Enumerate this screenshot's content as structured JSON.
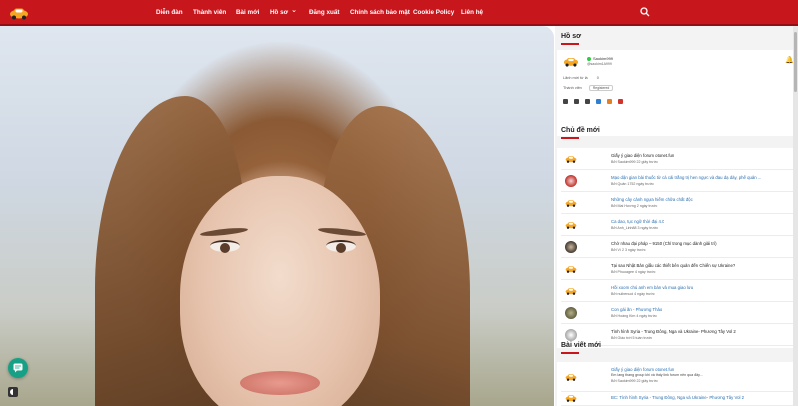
{
  "nav": {
    "items": [
      "Diễn đàn",
      "Thành viên",
      "Bài mới",
      "Hồ sơ",
      "Đăng xuất",
      "Chính sách bảo mật",
      "Cookie Policy",
      "Liên hệ"
    ],
    "search_icon": "search-icon",
    "brand_color": "#c8161d"
  },
  "profile": {
    "title": "Hồ sơ",
    "username": "Saokim999",
    "handle": "@saokim1A999",
    "row1_label": "Lãnh mới từ lá",
    "row1_value": "0",
    "row2_label": "Thành viên",
    "row2_tag": "Registered",
    "icons": [
      "user-icon",
      "settings-icon",
      "chat-icon",
      "mobile-icon",
      "rss-icon",
      "logout-icon"
    ]
  },
  "topics": {
    "title": "Chủ đề mới",
    "items": [
      {
        "title": "Giấy ý giao diện forum otonet.fun",
        "meta": "Bởi Saokim999 22 giây trước",
        "avatar": "car",
        "dark": true
      },
      {
        "title": "Mạo dận gian bài thuốc từ cá cải trắng trị hen ngực và đau dạ dày, phế quản ...",
        "meta": "Bởi Quân 1752 ngày trước",
        "avatar": "red",
        "dark": false
      },
      {
        "title": "Những cây cảnh ngựa hiếm chữa chất độc",
        "meta": "Bởi Mai Hương 2 ngày trước",
        "avatar": "car",
        "dark": false
      },
      {
        "title": "Ca dao, tục ngữ thời đại 4.0",
        "meta": "Bởi Anh_Linh88 3 ngày trước",
        "avatar": "car",
        "dark": false
      },
      {
        "title": "Chở nhau đại pháp – 9150 (Chỉ trong mục dành giải trí)",
        "meta": "Bởi Vì 2 3 ngày trước",
        "avatar": "dark",
        "dark": true
      },
      {
        "title": "Tại sao Nhật Bản giấu các thiết bên quản đến Chiến sự Ukraine?",
        "meta": "Bởi Phuoagee 4 ngày trước",
        "avatar": "car",
        "dark": true
      },
      {
        "title": "Hồi xoom chú anh em bàn và mua giao lưu",
        "meta": "Bởi nuibenuoi 4 ngày trước",
        "avatar": "car",
        "dark": false
      },
      {
        "title": "Con gái ăn - Phương Thảo",
        "meta": "Bởi Hoàng Kim 4 ngày trước",
        "avatar": "olive",
        "dark": false
      },
      {
        "title": "Tình hình Syria - Trung Đông, Nga và Ukraine- Phương Tây Vol 2",
        "meta": "Bởi Giáo trời 5 tuần trước",
        "avatar": "grey",
        "dark": true
      }
    ]
  },
  "posts": {
    "title": "Bài viết mới",
    "items": [
      {
        "title": "Giấy ý giao diện forum otonet.fun",
        "sub": "Em lang thang group khi và thấy link forum nên qua đây...",
        "meta": "Bởi Saokim999 22 giây trước"
      },
      {
        "title": "BC: Tình hình Syria - Trung Đông, Nga và Ukraine- Phương Tây Vol 2",
        "sub": "",
        "meta": ""
      }
    ]
  }
}
